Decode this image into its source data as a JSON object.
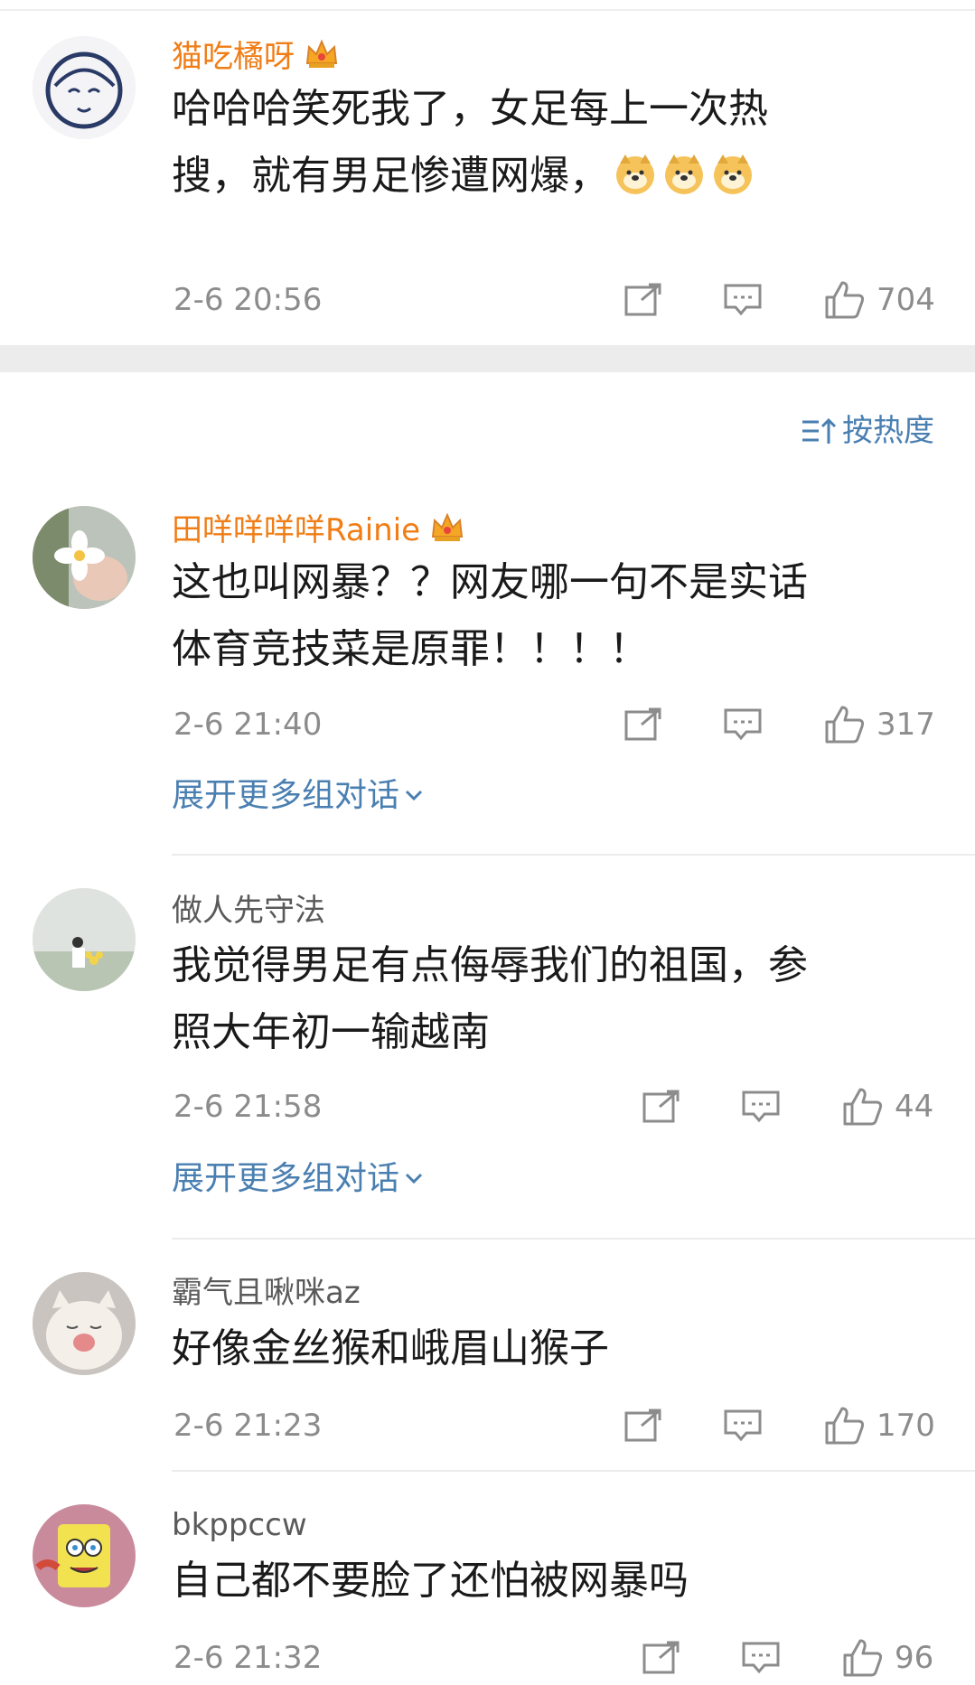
{
  "comments": [
    {
      "username": "猫吃橘呀",
      "vip": true,
      "lines": [
        "哈哈哈笑死我了，女足每上一次热",
        "搜，就有男足惨遭网爆，"
      ],
      "emoji": [
        "doge-emoji",
        "doge-emoji",
        "doge-emoji"
      ],
      "time": "2-6 20:56",
      "likes": "704"
    },
    {
      "username": "田咩咩咩咩Rainie",
      "vip": true,
      "lines": [
        "这也叫网暴？？网友哪一句不是实话",
        "体育竞技菜是原罪！！！！"
      ],
      "time": "2-6 21:40",
      "likes": "317",
      "expand_label": "展开更多组对话"
    },
    {
      "username": "做人先守法",
      "vip": false,
      "lines": [
        "我觉得男足有点侮辱我们的祖国，参",
        "照大年初一输越南"
      ],
      "time": "2-6 21:58",
      "likes": "44",
      "expand_label": "展开更多组对话"
    },
    {
      "username": "霸气且啾咪az",
      "vip": false,
      "lines": [
        "好像金丝猴和峨眉山猴子"
      ],
      "time": "2-6 21:23",
      "likes": "170"
    },
    {
      "username": "bkppccw",
      "vip": false,
      "lines": [
        "自己都不要脸了还怕被网暴吗"
      ],
      "time": "2-6 21:32",
      "likes": "96"
    }
  ],
  "sort_label": "按热度",
  "colors": {
    "vip_name": "#f07d16",
    "link": "#4a7fb1",
    "meta": "#8c8c8c"
  }
}
